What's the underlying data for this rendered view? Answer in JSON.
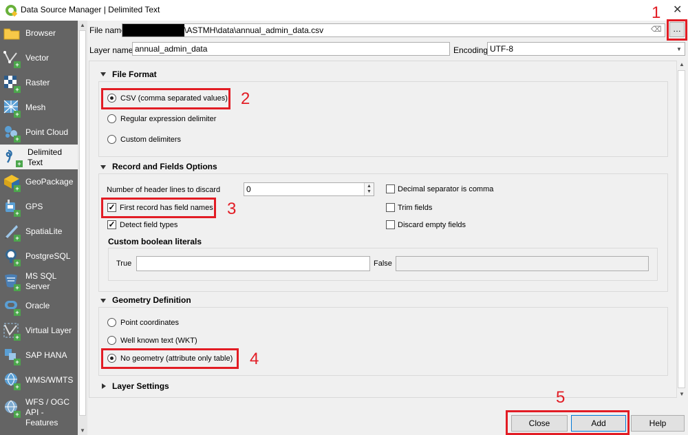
{
  "window": {
    "title": "Data Source Manager | Delimited Text"
  },
  "sidebar": {
    "items": [
      {
        "label": "Browser",
        "icon": "folder-icon"
      },
      {
        "label": "Vector",
        "icon": "vector-icon"
      },
      {
        "label": "Raster",
        "icon": "raster-icon"
      },
      {
        "label": "Mesh",
        "icon": "mesh-icon"
      },
      {
        "label": "Point Cloud",
        "icon": "point-cloud-icon"
      },
      {
        "label": "Delimited Text",
        "icon": "delimited-text-icon"
      },
      {
        "label": "GeoPackage",
        "icon": "geopackage-icon"
      },
      {
        "label": "GPS",
        "icon": "gps-icon"
      },
      {
        "label": "SpatiaLite",
        "icon": "spatialite-icon"
      },
      {
        "label": "PostgreSQL",
        "icon": "postgresql-icon"
      },
      {
        "label": "MS SQL Server",
        "icon": "mssql-icon"
      },
      {
        "label": "Oracle",
        "icon": "oracle-icon"
      },
      {
        "label": "Virtual Layer",
        "icon": "virtual-layer-icon"
      },
      {
        "label": "SAP HANA",
        "icon": "sap-hana-icon"
      },
      {
        "label": "WMS/WMTS",
        "icon": "wms-icon"
      },
      {
        "label": "WFS / OGC API - Features",
        "icon": "wfs-icon"
      }
    ]
  },
  "form": {
    "file_name_label": "File name",
    "file_name_value": "\\ASTMH\\data\\annual_admin_data.csv",
    "browse_label": "…",
    "layer_name_label": "Layer name",
    "layer_name_value": "annual_admin_data",
    "encoding_label": "Encoding",
    "encoding_value": "UTF-8"
  },
  "file_format": {
    "title": "File Format",
    "options": [
      {
        "label": "CSV (comma separated values)",
        "selected": true
      },
      {
        "label": "Regular expression delimiter",
        "selected": false
      },
      {
        "label": "Custom delimiters",
        "selected": false
      }
    ]
  },
  "record_fields": {
    "title": "Record and Fields Options",
    "header_lines_label": "Number of header lines to discard",
    "header_lines_value": "0",
    "first_record_label": "First record has field names",
    "detect_types_label": "Detect field types",
    "decimal_comma_label": "Decimal separator is comma",
    "trim_fields_label": "Trim fields",
    "discard_empty_label": "Discard empty fields",
    "custom_boolean_title": "Custom boolean literals",
    "true_label": "True",
    "false_label": "False"
  },
  "geometry": {
    "title": "Geometry Definition",
    "options": [
      {
        "label": "Point coordinates",
        "selected": false
      },
      {
        "label": "Well known text (WKT)",
        "selected": false
      },
      {
        "label": "No geometry (attribute only table)",
        "selected": true
      }
    ]
  },
  "layer_settings": {
    "title": "Layer Settings"
  },
  "buttons": {
    "close": "Close",
    "add": "Add",
    "help": "Help"
  },
  "annotations": {
    "n1": "1",
    "n2": "2",
    "n3": "3",
    "n4": "4",
    "n5": "5"
  },
  "colors": {
    "highlight": "#e21c24",
    "sidebar_bg": "#646464",
    "qgis_green": "#69b13b"
  }
}
